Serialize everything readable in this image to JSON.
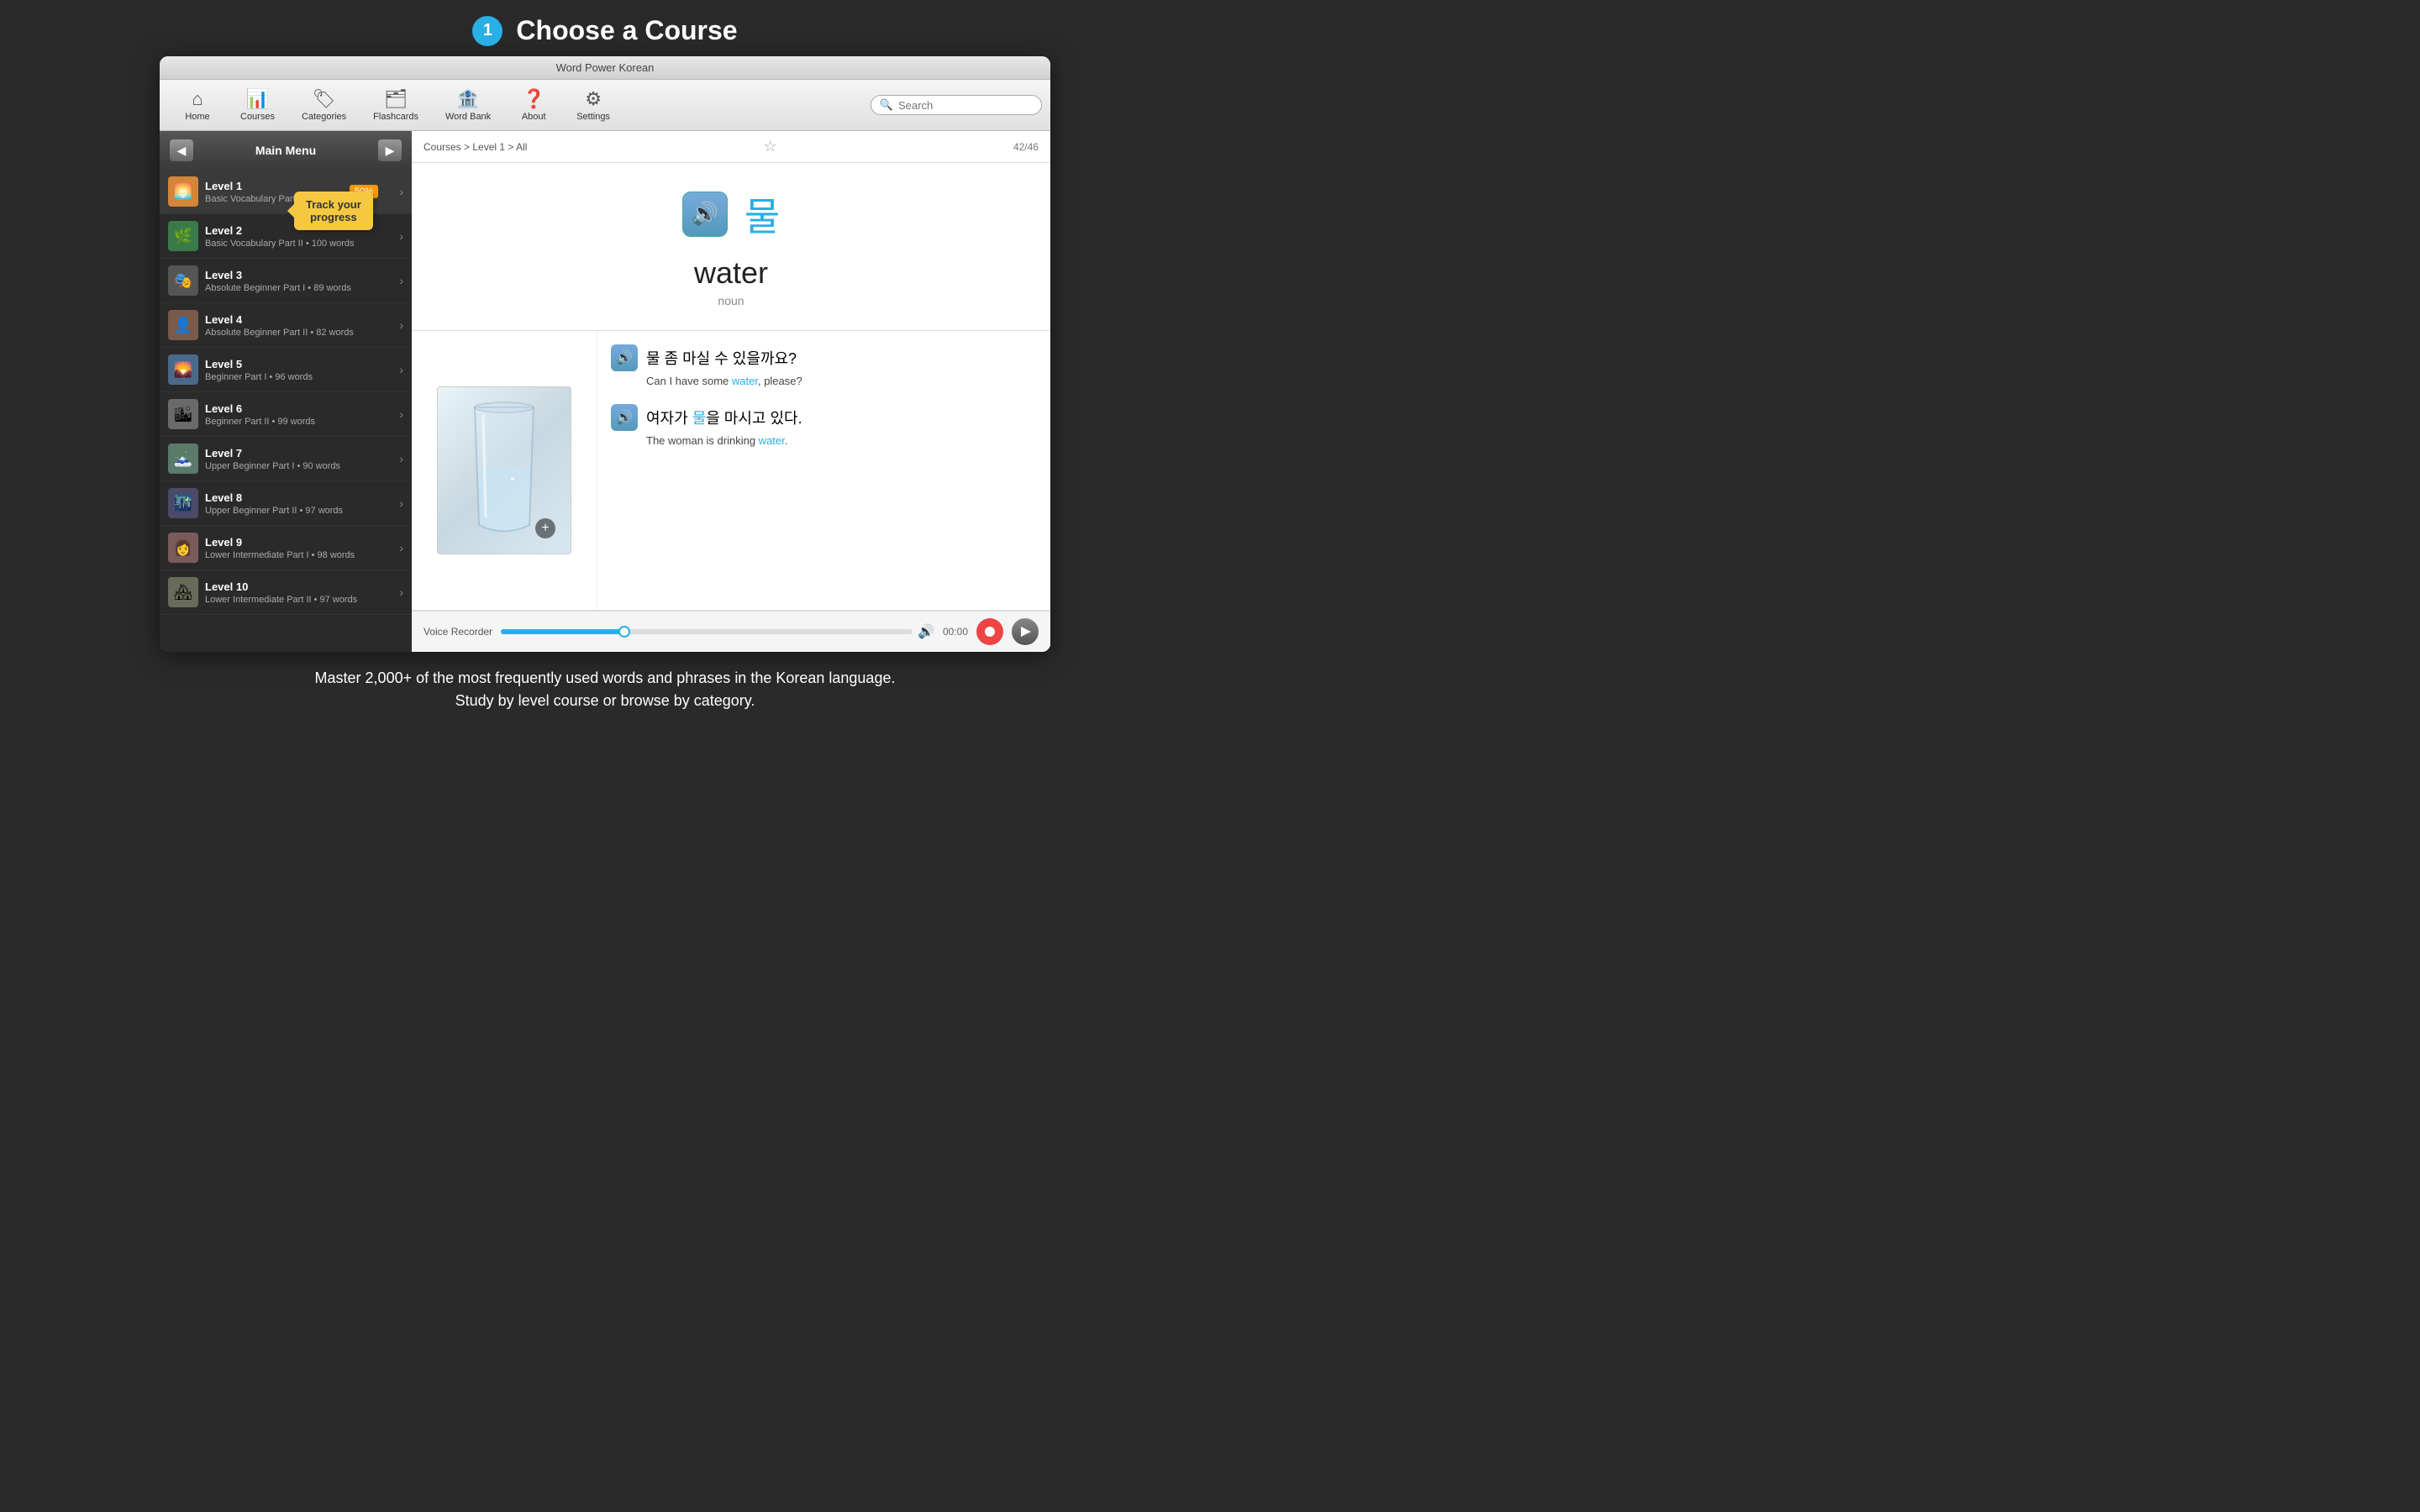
{
  "header": {
    "step_number": "1",
    "title": "Choose a Course"
  },
  "window": {
    "title": "Word Power Korean"
  },
  "toolbar": {
    "items": [
      {
        "id": "home",
        "icon": "⌂",
        "label": "Home"
      },
      {
        "id": "courses",
        "icon": "📊",
        "label": "Courses"
      },
      {
        "id": "categories",
        "icon": "🏷",
        "label": "Categories"
      },
      {
        "id": "flashcards",
        "icon": "🗂",
        "label": "Flashcards"
      },
      {
        "id": "wordbank",
        "icon": "🏦",
        "label": "Word Bank"
      },
      {
        "id": "about",
        "icon": "❓",
        "label": "About"
      },
      {
        "id": "settings",
        "icon": "⚙",
        "label": "Settings"
      }
    ],
    "search_placeholder": "Search"
  },
  "sidebar": {
    "title": "Main Menu",
    "levels": [
      {
        "id": 1,
        "name": "Level 1",
        "desc": "Basic Vocabulary Part I • 87 words",
        "thumb": "🌅",
        "progress": 50,
        "active": true
      },
      {
        "id": 2,
        "name": "Level 2",
        "desc": "Basic Vocabulary Part II • 100 words",
        "thumb": "🌿",
        "progress": 0
      },
      {
        "id": 3,
        "name": "Level 3",
        "desc": "Absolute Beginner Part I • 89 words",
        "thumb": "🎭",
        "progress": 0
      },
      {
        "id": 4,
        "name": "Level 4",
        "desc": "Absolute Beginner Part II • 82 words",
        "thumb": "👤",
        "progress": 0
      },
      {
        "id": 5,
        "name": "Level 5",
        "desc": "Beginner Part I • 96 words",
        "thumb": "🌄",
        "progress": 0
      },
      {
        "id": 6,
        "name": "Level 6",
        "desc": "Beginner Part II • 99 words",
        "thumb": "🏙",
        "progress": 0
      },
      {
        "id": 7,
        "name": "Level 7",
        "desc": "Upper Beginner Part I • 90 words",
        "thumb": "🗻",
        "progress": 0
      },
      {
        "id": 8,
        "name": "Level 8",
        "desc": "Upper Beginner Part II • 97 words",
        "thumb": "🌃",
        "progress": 0
      },
      {
        "id": 9,
        "name": "Level 9",
        "desc": "Lower Intermediate Part I • 98 words",
        "thumb": "👩",
        "progress": 0
      },
      {
        "id": 10,
        "name": "Level 10",
        "desc": "Lower Intermediate Part II • 97 words",
        "thumb": "🏘",
        "progress": 0
      }
    ],
    "tooltip": "Track your\nprogress"
  },
  "main": {
    "breadcrumb": "Courses > Level 1 > All",
    "page_count": "42/46",
    "korean_char": "물",
    "english_word": "water",
    "word_pos": "noun",
    "sentences": [
      {
        "korean": "물 좀 마실 수 있을까요?",
        "english_prefix": "Can I have some ",
        "highlight": "water",
        "english_suffix": ", please?"
      },
      {
        "korean": "여자가 물을 마시고 있다.",
        "english_prefix": "The woman is drinking ",
        "highlight": "water",
        "english_suffix": "."
      }
    ],
    "voice_recorder": {
      "label": "Voice Recorder",
      "time": "00:00",
      "progress": 30
    }
  },
  "footer": {
    "line1": "Master 2,000+ of the most frequently used words and phrases in the Korean language.",
    "line2": "Study by level course or browse by category."
  }
}
